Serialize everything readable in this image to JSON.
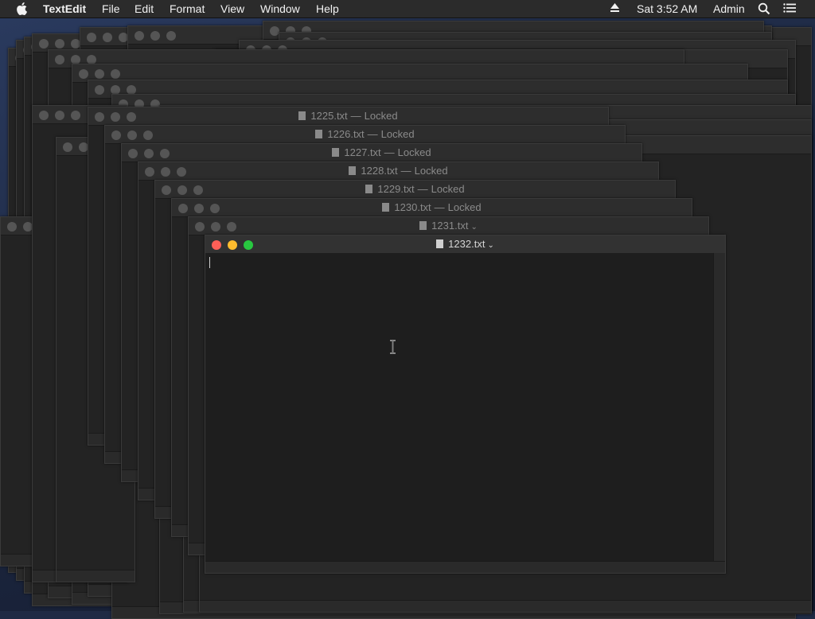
{
  "menubar": {
    "app_name": "TextEdit",
    "items": [
      "File",
      "Edit",
      "Format",
      "View",
      "Window",
      "Help"
    ],
    "clock": "Sat 3:52 AM",
    "user": "Admin",
    "icons": [
      "apple-icon",
      "eject-icon",
      "spotlight-search-icon",
      "notification-center-icon"
    ]
  },
  "windows": {
    "locked_suffix": "Locked",
    "stack": [
      {
        "title": "1225.txt",
        "locked": true
      },
      {
        "title": "1226.txt",
        "locked": true
      },
      {
        "title": "1227.txt",
        "locked": true
      },
      {
        "title": "1228.txt",
        "locked": true
      },
      {
        "title": "1229.txt",
        "locked": true
      },
      {
        "title": "1230.txt",
        "locked": true
      },
      {
        "title": "1231.txt",
        "locked": false
      }
    ],
    "front": {
      "title": "1232.txt",
      "content": ""
    }
  },
  "colors": {
    "close": "#fe5f57",
    "minimize": "#febc2e",
    "zoom": "#28c840"
  }
}
